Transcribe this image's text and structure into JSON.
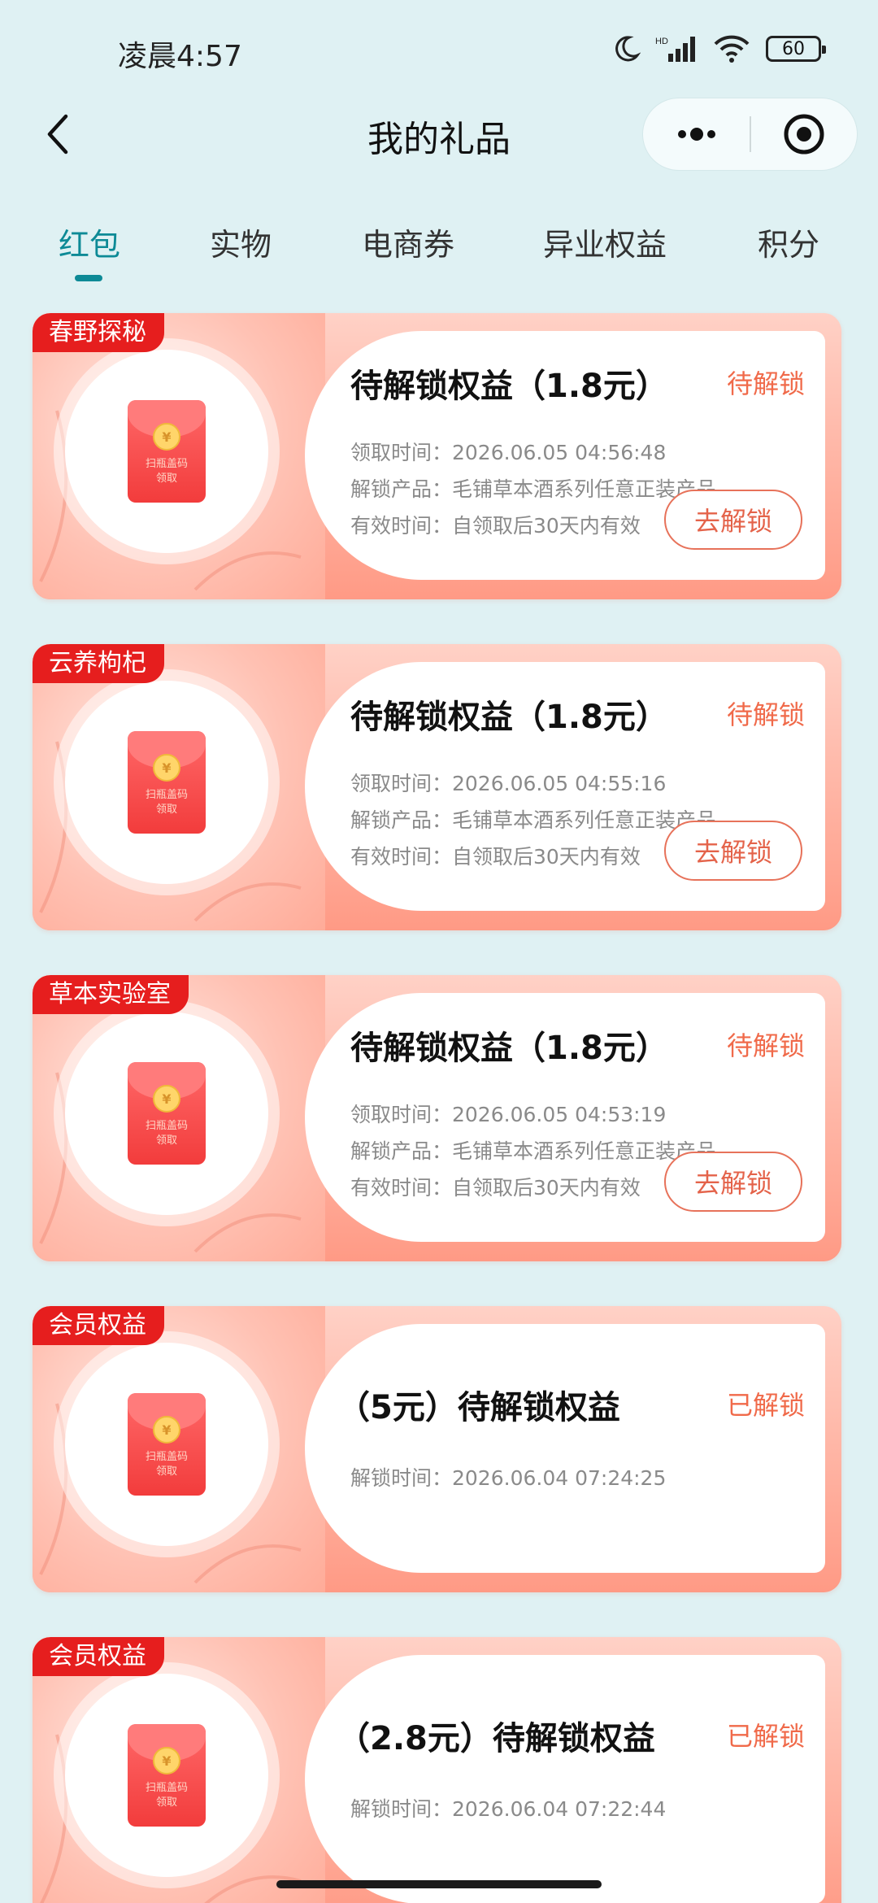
{
  "status_bar": {
    "time": "凌晨4:57",
    "battery": "60",
    "network": "HD"
  },
  "nav": {
    "title": "我的礼品"
  },
  "tabs": [
    {
      "label": "红包",
      "active": true
    },
    {
      "label": "实物",
      "active": false
    },
    {
      "label": "电商券",
      "active": false
    },
    {
      "label": "异业权益",
      "active": false
    },
    {
      "label": "积分",
      "active": false
    }
  ],
  "envelope": {
    "coin": "¥",
    "line1": "扫瓶盖码",
    "line2": "领取"
  },
  "cards": [
    {
      "tag": "春野探秘",
      "title": "待解锁权益（1.8元）",
      "status": "待解锁",
      "details": [
        "领取时间：2026.06.05 04:56:48",
        "解锁产品：毛铺草本酒系列任意正装产品",
        "有效时间：自领取后30天内有效"
      ],
      "button": "去解锁"
    },
    {
      "tag": "云养枸杞",
      "title": "待解锁权益（1.8元）",
      "status": "待解锁",
      "details": [
        "领取时间：2026.06.05 04:55:16",
        "解锁产品：毛铺草本酒系列任意正装产品",
        "有效时间：自领取后30天内有效"
      ],
      "button": "去解锁"
    },
    {
      "tag": "草本实验室",
      "title": "待解锁权益（1.8元）",
      "status": "待解锁",
      "details": [
        "领取时间：2026.06.05 04:53:19",
        "解锁产品：毛铺草本酒系列任意正装产品",
        "有效时间：自领取后30天内有效"
      ],
      "button": "去解锁"
    },
    {
      "tag": "会员权益",
      "title": "（5元）待解锁权益",
      "status": "已解锁",
      "details": [
        "解锁时间：2026.06.04 07:24:25"
      ]
    },
    {
      "tag": "会员权益",
      "title": "（2.8元）待解锁权益",
      "status": "已解锁",
      "details": [
        "解锁时间：2026.06.04 07:22:44"
      ]
    }
  ],
  "colors": {
    "background": "#dff1f3",
    "accent": "#0d8a96",
    "tag": "#e61e1e",
    "status": "#f06a4a"
  }
}
